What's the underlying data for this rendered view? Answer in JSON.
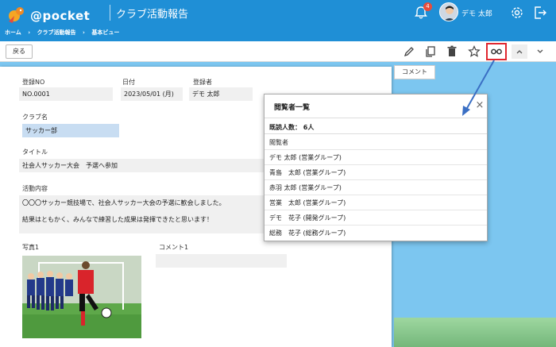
{
  "header": {
    "logo_text": "@pocket",
    "app_title": "クラブ活動報告",
    "notification_count": "4",
    "user_name": "デモ 太郎"
  },
  "breadcrumb": [
    "ホーム",
    "›",
    "クラブ活動報告",
    "›",
    "基本ビュー"
  ],
  "toolbar": {
    "back_label": "戻る",
    "icons": [
      "edit-icon",
      "copy-icon",
      "delete-icon",
      "star-icon",
      "viewers-icon",
      "collapse-icon",
      "expand-icon"
    ]
  },
  "comment_tab": "コメント",
  "form": {
    "reg_no_label": "登録NO",
    "reg_no_value": "NO.0001",
    "date_label": "日付",
    "date_value": "2023/05/01 (月)",
    "registrant_label": "登録者",
    "registrant_value": "デモ 太郎",
    "club_label": "クラブ名",
    "club_value": "サッカー部",
    "title_label": "タイトル",
    "title_value": "社会人サッカー大会　予選へ参加",
    "content_label": "活動内容",
    "content_lines": [
      "〇〇〇サッカー競技場で、社会人サッカー大会の予選に歓会しました。",
      "結果はともかく、みんなで練習した成果は発揮できたと思います！"
    ],
    "photo_label": "写真1",
    "comment_label": "コメント1"
  },
  "viewers_popup": {
    "title": "閲覧者一覧",
    "close": "×",
    "count_text": "既読人数： 6人",
    "column_header": "閲覧者",
    "viewers": [
      "デモ 太郎 (営業グループ)",
      "青島　太郎 (営業グループ)",
      "赤羽 太郎 (営業グループ)",
      "営業　太郎 (営業グループ)",
      "デモ　花子 (開発グループ)",
      "総務　花子 (総務グループ)"
    ]
  },
  "colors": {
    "header_bg": "#1f8fd6",
    "highlight_border": "#e0272f",
    "arrow": "#3a6fc4",
    "badge": "#e74c3c"
  }
}
